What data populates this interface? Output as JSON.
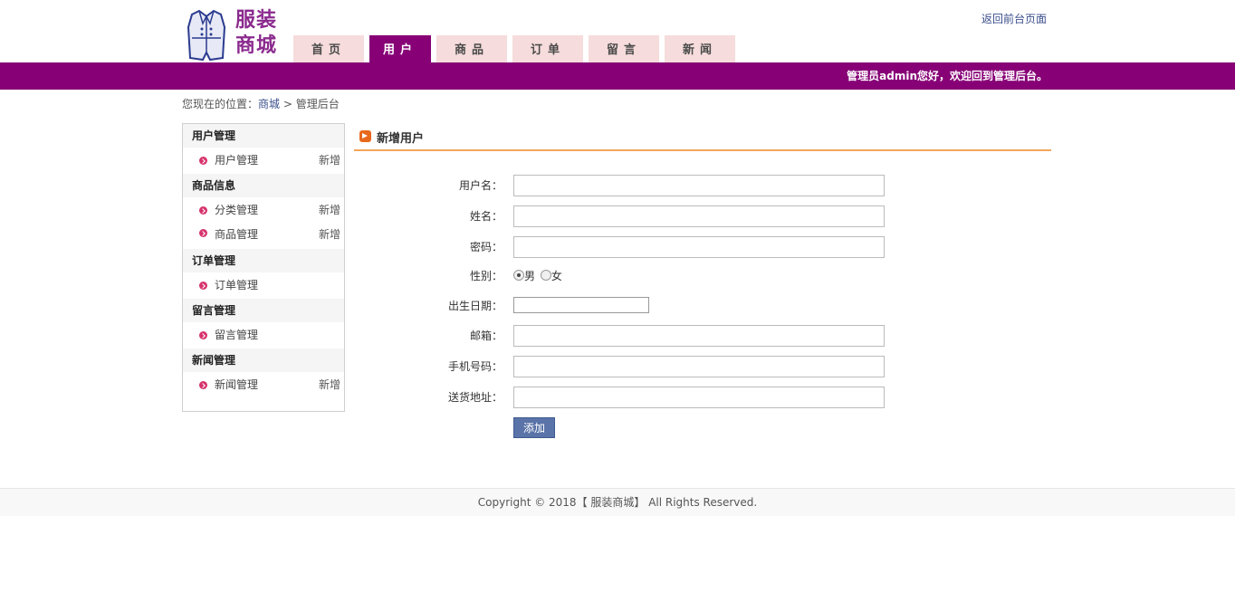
{
  "header": {
    "logo_text": "服装商城",
    "back_link": "返回前台页面"
  },
  "nav": {
    "tabs": [
      {
        "label": "首页",
        "active": false
      },
      {
        "label": "用户",
        "active": true
      },
      {
        "label": "商品",
        "active": false
      },
      {
        "label": "订单",
        "active": false
      },
      {
        "label": "留言",
        "active": false
      },
      {
        "label": "新闻",
        "active": false
      }
    ]
  },
  "topbar": {
    "welcome": "管理员admin您好，欢迎回到管理后台。"
  },
  "breadcrumb": {
    "prefix": "您现在的位置：",
    "link": "商城",
    "separator": " > ",
    "current": "管理后台"
  },
  "sidebar": {
    "groups": [
      {
        "title": "用户管理",
        "items": [
          {
            "label": "用户管理",
            "add": "新增"
          }
        ]
      },
      {
        "title": "商品信息",
        "items": [
          {
            "label": "分类管理",
            "add": "新增"
          },
          {
            "label": "商品管理",
            "add": "新增"
          }
        ]
      },
      {
        "title": "订单管理",
        "items": [
          {
            "label": "订单管理",
            "add": ""
          }
        ]
      },
      {
        "title": "留言管理",
        "items": [
          {
            "label": "留言管理",
            "add": ""
          }
        ]
      },
      {
        "title": "新闻管理",
        "items": [
          {
            "label": "新闻管理",
            "add": "新增"
          }
        ]
      }
    ]
  },
  "main": {
    "title": "新增用户"
  },
  "form": {
    "username_label": "用户名：",
    "username_value": "",
    "name_label": "姓名：",
    "name_value": "",
    "password_label": "密码：",
    "password_value": "",
    "gender_label": "性别：",
    "gender_male": "男",
    "gender_female": "女",
    "gender_selected": "男",
    "birth_label": "出生日期：",
    "birth_value": "",
    "email_label": "邮箱：",
    "email_value": "",
    "phone_label": "手机号码：",
    "phone_value": "",
    "address_label": "送货地址：",
    "address_value": "",
    "submit_label": "添加"
  },
  "footer": {
    "copyright": "Copyright © 2018【 服装商城】 All Rights Reserved."
  },
  "colors": {
    "brand": "#870076",
    "tab_inactive": "#f6dcdc",
    "title_rule": "#f3a75a",
    "button": "#5a73a8",
    "bullet": "#d6336c"
  }
}
